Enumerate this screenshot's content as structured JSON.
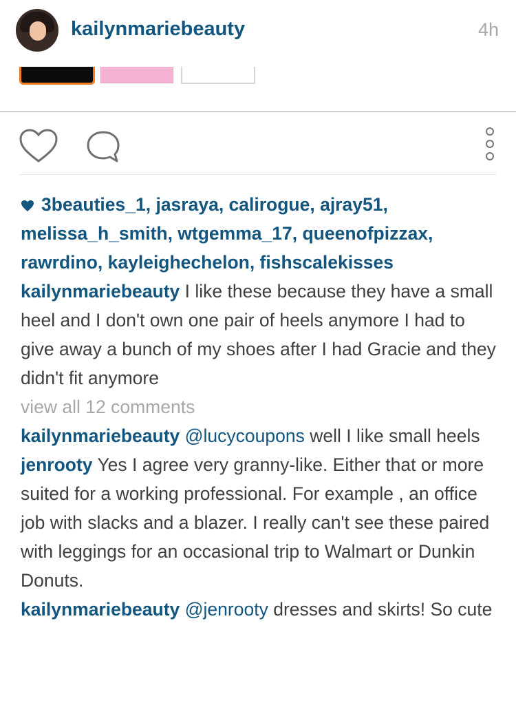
{
  "post": {
    "username": "kailynmariebeauty",
    "time": "4h"
  },
  "likes": {
    "text": "3beauties_1, jasraya, calirogue, ajray51, melissa_h_smith, wtgemma_17, queenofpizzax, rawrdino, kayleighechelon, fishscalekisses"
  },
  "caption": {
    "username": "kailynmariebeauty",
    "text": "I like these because they have a small heel and I don't own one pair of heels anymore I had to give away a bunch of my shoes after I had Gracie and they didn't fit anymore"
  },
  "view_all": "view all 12 comments",
  "comments": [
    {
      "username": "kailynmariebeauty",
      "mention": "@lucycoupons",
      "text": "well I like small heels"
    },
    {
      "username": "jenrooty",
      "mention": "",
      "text": "Yes I agree very granny-like. Either that or more suited for a working professional. For example , an office job with slacks and a blazer. I really can't see these paired with leggings for an occasional trip to Walmart or Dunkin Donuts."
    },
    {
      "username": "kailynmariebeauty",
      "mention": "@jenrooty",
      "text": "dresses and skirts! So cute"
    }
  ],
  "icons": {
    "like": "heart-outline-icon",
    "comment": "speech-bubble-icon",
    "more": "vertical-dots-icon",
    "likes": "heart-filled-icon"
  },
  "colors": {
    "link": "#12557f",
    "muted": "#a8a8a8",
    "text": "#3f3f3f",
    "swatch_black": "#0c0c0c",
    "swatch_pink": "#f5b3d4",
    "swatch_orange_border": "#f07a22"
  }
}
